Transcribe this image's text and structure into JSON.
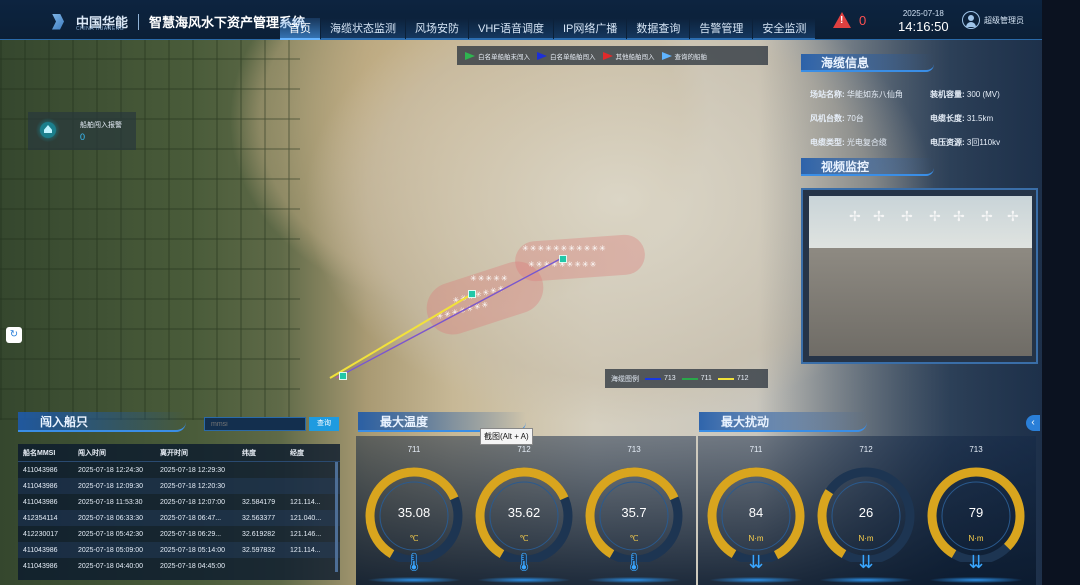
{
  "header": {
    "logo_cn": "中国华能",
    "logo_en": "CHINA HUANENG",
    "system_title": "智慧海风水下资产管理系统",
    "nav": [
      "首页",
      "海缆状态监测",
      "风场安防",
      "VHF语音调度",
      "IP网络广播",
      "数据查询",
      "告警管理",
      "安全监测"
    ],
    "alarm_count": "0",
    "date": "2025-07-18",
    "time": "14:16:50",
    "user": "超级管理员"
  },
  "map_legend": {
    "items": [
      {
        "label": "白名单船舶未闯入",
        "color": "#2fb550"
      },
      {
        "label": "白名单船舶闯入",
        "color": "#1c2fd8"
      },
      {
        "label": "其他船舶闯入",
        "color": "#e02a2a"
      },
      {
        "label": "查询的船舶",
        "color": "#5fb4ff"
      }
    ]
  },
  "intrusion_alarm": {
    "label": "船舶闯入报警",
    "value": "0"
  },
  "cable_legend": {
    "title": "海缆图例",
    "items": [
      {
        "label": "713",
        "color": "#1838e0"
      },
      {
        "label": "711",
        "color": "#2aa84a"
      },
      {
        "label": "712",
        "color": "#f2e23a"
      }
    ]
  },
  "cable_info": {
    "title": "海缆信息",
    "rows": [
      [
        {
          "k": "场站名称:",
          "v": "华能如东八仙角"
        },
        {
          "k": "装机容量:",
          "v": "300 (MV)"
        }
      ],
      [
        {
          "k": "风机台数:",
          "v": "70台"
        },
        {
          "k": "电缆长度:",
          "v": "31.5km"
        }
      ],
      [
        {
          "k": "电缆类型:",
          "v": "光电复合缆"
        },
        {
          "k": "电压资源:",
          "v": "3回110kv"
        }
      ]
    ]
  },
  "video": {
    "title": "视频监控"
  },
  "ships": {
    "title": "闯入船只",
    "search_placeholder": "mmsi",
    "search_label": "查询",
    "columns": [
      "船名MMSI",
      "闯入时间",
      "离开时间",
      "纬度",
      "经度"
    ],
    "rows": [
      [
        "411043986",
        "2025-07-18 12:24:30",
        "2025-07-18 12:29:30",
        "",
        ""
      ],
      [
        "411043986",
        "2025-07-18 12:09:30",
        "2025-07-18 12:20:30",
        "",
        ""
      ],
      [
        "411043986",
        "2025-07-18 11:53:30",
        "2025-07-18 12:07:00",
        "32.584179",
        "121.114..."
      ],
      [
        "412354114",
        "2025-07-18 06:33:30",
        "2025-07-18 06:47...",
        "32.563377",
        "121.040..."
      ],
      [
        "412230017",
        "2025-07-18 05:42:30",
        "2025-07-18 06:29...",
        "32.619282",
        "121.146..."
      ],
      [
        "411043986",
        "2025-07-18 05:09:00",
        "2025-07-18 05:14:00",
        "32.597832",
        "121.114..."
      ],
      [
        "411043986",
        "2025-07-18 04:40:00",
        "2025-07-18 04:45:00",
        "",
        ""
      ]
    ]
  },
  "max_temp": {
    "title": "最大温度",
    "unit": "℃",
    "gauges": [
      {
        "label": "711",
        "value": "35.08",
        "fraction": 0.6
      },
      {
        "label": "712",
        "value": "35.62",
        "fraction": 0.6
      },
      {
        "label": "713",
        "value": "35.7",
        "fraction": 0.6
      }
    ]
  },
  "max_strain": {
    "title": "最大扰动",
    "unit": "N·m",
    "gauges": [
      {
        "label": "711",
        "value": "84",
        "fraction": 0.84
      },
      {
        "label": "712",
        "value": "26",
        "fraction": 0.26
      },
      {
        "label": "713",
        "value": "79",
        "fraction": 0.79
      }
    ]
  },
  "tooltip": "截图(Alt + A)",
  "colors": {
    "accent": "#3a8ee6",
    "gauge": "#d9a51e",
    "track": "#1d3552"
  }
}
